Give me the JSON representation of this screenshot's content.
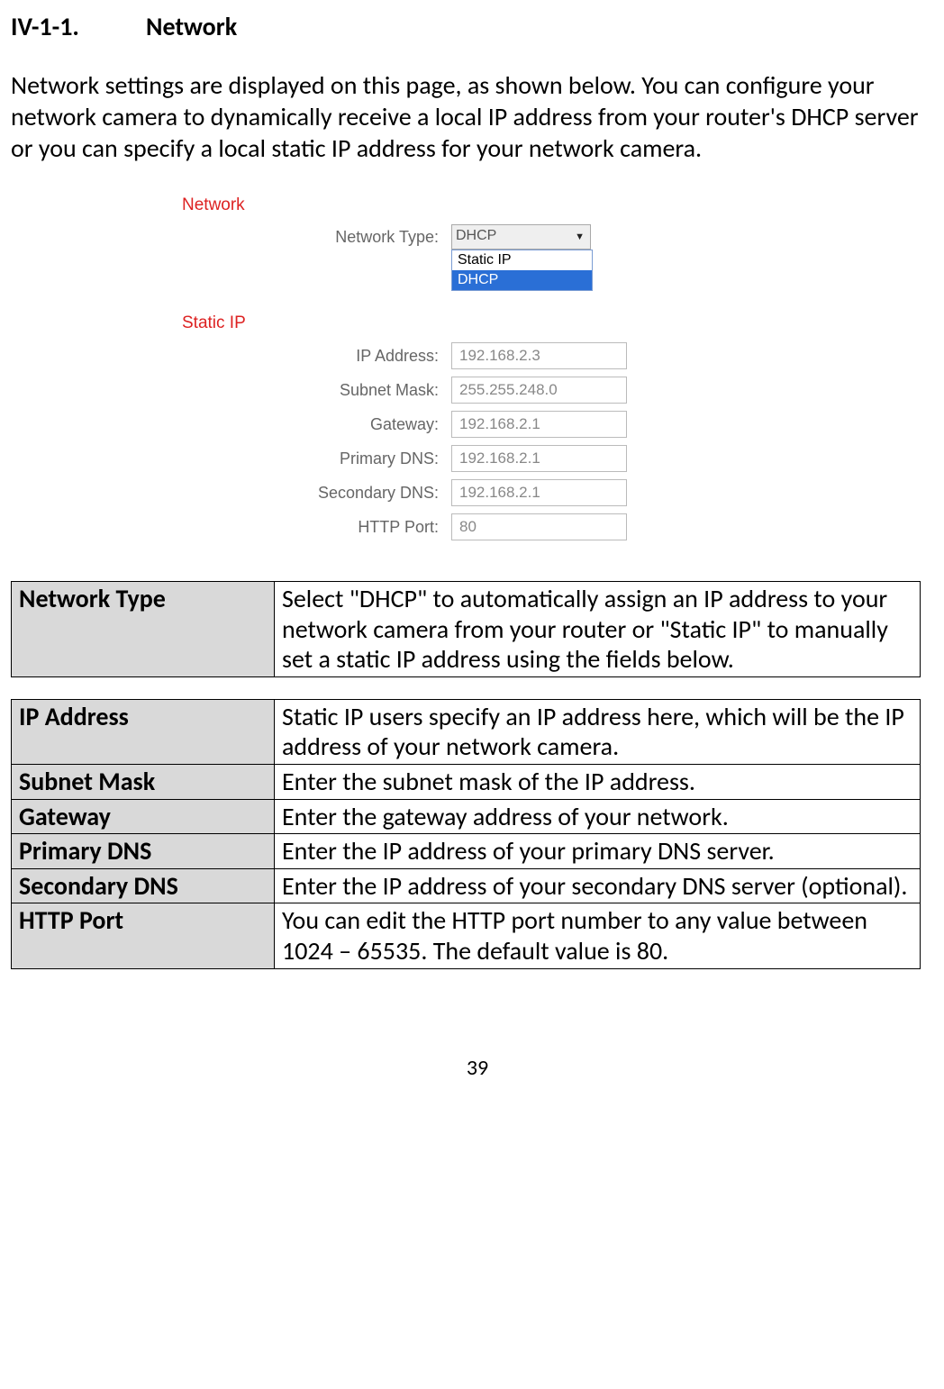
{
  "heading": {
    "number": "IV-1-1.",
    "title": "Network"
  },
  "intro": "Network settings are displayed on this page, as shown below. You can configure your network camera to dynamically receive a local IP address from your router's DHCP server or you can specify a local static IP address for your network camera.",
  "config": {
    "section_network": "Network",
    "network_type_label": "Network Type:",
    "network_type_selected": "DHCP",
    "network_type_options": [
      "Static IP",
      "DHCP"
    ],
    "section_static": "Static IP",
    "fields": {
      "ip_address": {
        "label": "IP Address:",
        "value": "192.168.2.3"
      },
      "subnet_mask": {
        "label": "Subnet Mask:",
        "value": "255.255.248.0"
      },
      "gateway": {
        "label": "Gateway:",
        "value": "192.168.2.1"
      },
      "primary_dns": {
        "label": "Primary DNS:",
        "value": "192.168.2.1"
      },
      "secondary_dns": {
        "label": "Secondary DNS:",
        "value": "192.168.2.1"
      },
      "http_port": {
        "label": "HTTP Port:",
        "value": "80"
      }
    }
  },
  "table1": [
    {
      "name": "Network Type",
      "desc": "Select \"DHCP\" to automatically assign an IP address to your network camera from your router or \"Static IP\" to manually set a static IP address using the fields below."
    }
  ],
  "table2": [
    {
      "name": "IP Address",
      "desc": "Static IP users specify an IP address here, which will be the IP address of your network camera."
    },
    {
      "name": "Subnet Mask",
      "desc": "Enter the subnet mask of the IP address."
    },
    {
      "name": "Gateway",
      "desc": "Enter the gateway address of your network."
    },
    {
      "name": "Primary DNS",
      "desc": "Enter the IP address of your primary DNS server."
    },
    {
      "name": "Secondary DNS",
      "desc": "Enter the IP address of your secondary DNS server (optional)."
    },
    {
      "name": "HTTP Port",
      "desc": "You can edit the HTTP port number to any value between 1024 – 65535. The default value is 80."
    }
  ],
  "page_number": "39"
}
